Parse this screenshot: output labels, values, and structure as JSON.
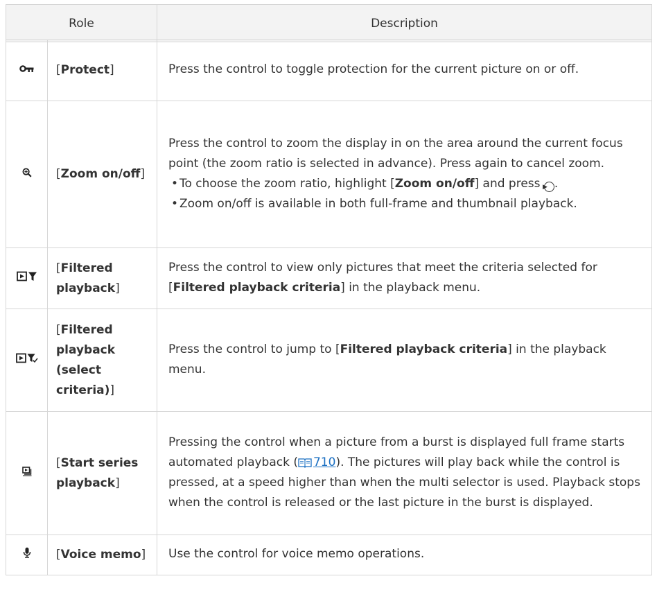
{
  "header": {
    "role": "Role",
    "description": "Description"
  },
  "rows": [
    {
      "icon": "protect-key-icon",
      "role": "Protect",
      "desc": "Press the control to toggle protection for the current picture on or off."
    },
    {
      "icon": "zoom-magnifier-icon",
      "role": "Zoom on/off",
      "desc": "Press the control to zoom the display in on the area around the current focus point (the zoom ratio is selected in advance). Press again to cancel zoom.",
      "bullet1_pre": "To choose the zoom ratio, highlight [",
      "bullet1_bold": "Zoom on/off",
      "bullet1_post": "] and press",
      "bullet2": "Zoom on/off is available in both full-frame and thumbnail playback."
    },
    {
      "icon": "filtered-playback-icon",
      "role": "Filtered playback",
      "desc_pre": "Press the control to view only pictures that meet the criteria selected for [",
      "desc_bold": "Filtered playback criteria",
      "desc_post": "] in the playback menu."
    },
    {
      "icon": "filtered-playback-select-icon",
      "role": "Filtered playback (select criteria)",
      "desc_pre": "Press the control to jump to [",
      "desc_bold": "Filtered playback criteria",
      "desc_post": "] in the playback menu."
    },
    {
      "icon": "series-playback-icon",
      "role": "Start series playback",
      "desc_pre": "Pressing the control when a picture from a burst is displayed full frame starts automated playback (",
      "desc_link": "710",
      "desc_post": "). The pictures will play back while the control is pressed, at a speed higher than when the multi selector is used. Playback stops when the control is released or the last picture in the burst is displayed."
    },
    {
      "icon": "microphone-icon",
      "role": "Voice memo",
      "desc": "Use the control for voice memo operations."
    }
  ],
  "colors": {
    "header_bg": "#f3f3f3",
    "border": "#d6d6d6",
    "link": "#1a6fc2"
  }
}
